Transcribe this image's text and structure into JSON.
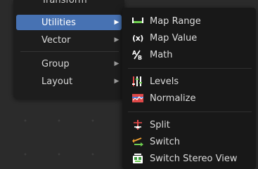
{
  "parent_menu": {
    "cut_off_item": "Transform",
    "items": [
      {
        "label": "Utilities",
        "active": true
      },
      {
        "label": "Vector",
        "active": false
      },
      {
        "label": "Group",
        "active": false
      },
      {
        "label": "Layout",
        "active": false
      }
    ]
  },
  "submenu": {
    "items": [
      {
        "label": "Map Range",
        "icon": "map-range-icon"
      },
      {
        "label": "Map Value",
        "icon": "map-value-icon",
        "icon_text": "(x)"
      },
      {
        "label": "Math",
        "icon": "math-icon"
      },
      {
        "label": "Levels",
        "icon": "levels-icon"
      },
      {
        "label": "Normalize",
        "icon": "normalize-icon"
      },
      {
        "label": "Split",
        "icon": "split-icon"
      },
      {
        "label": "Switch",
        "icon": "switch-icon"
      },
      {
        "label": "Switch Stereo View",
        "icon": "switch-stereo-view-icon"
      }
    ]
  },
  "colors": {
    "active_item": "#4772b3",
    "menu_bg": "#181818",
    "accent_green": "#6fcf4f",
    "accent_red": "#e04848"
  }
}
